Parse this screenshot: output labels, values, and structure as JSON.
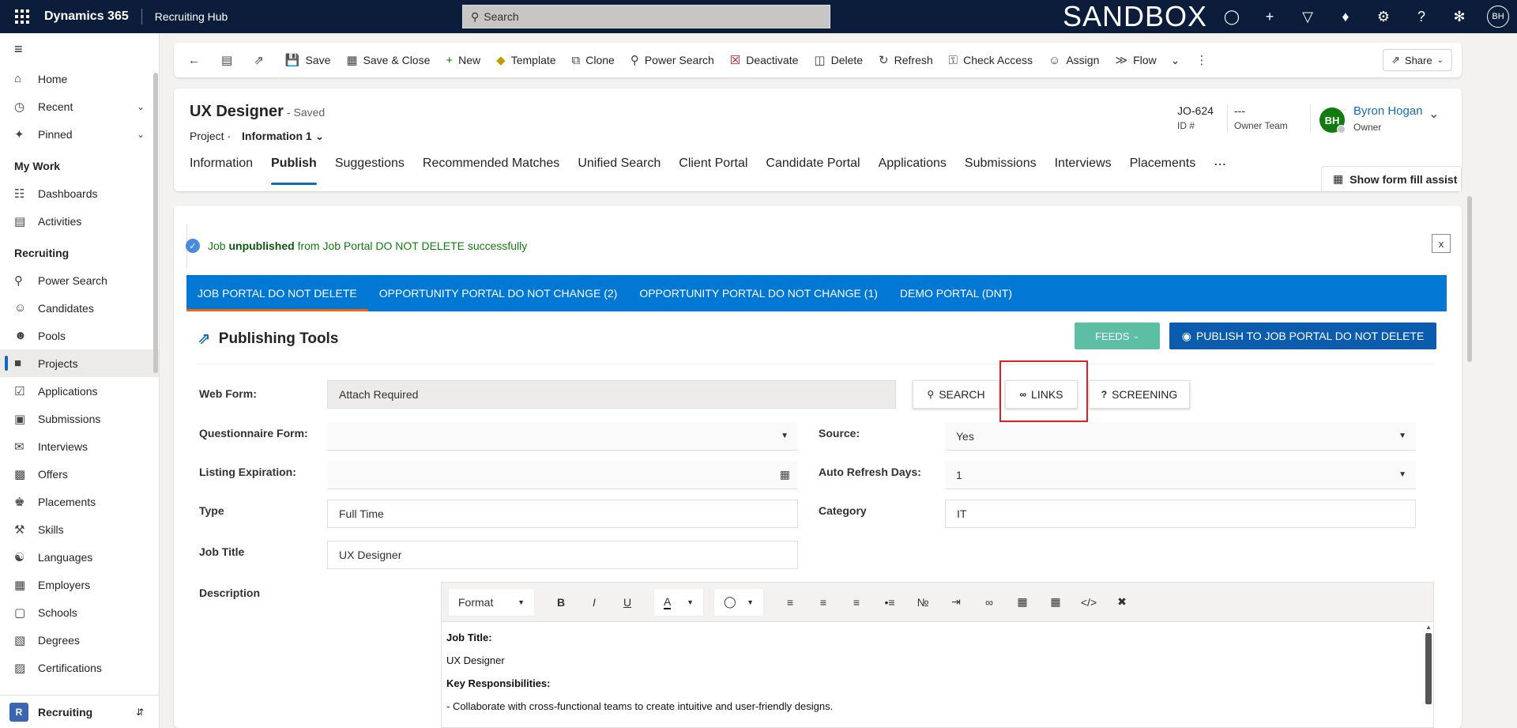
{
  "topbar": {
    "app_name": "Dynamics 365",
    "hub_name": "Recruiting Hub",
    "search_placeholder": "Search",
    "env_label": "SANDBOX",
    "user_initials": "BH"
  },
  "sidebar": {
    "items_top": [
      {
        "label": "Home",
        "icon": "home-icon"
      },
      {
        "label": "Recent",
        "icon": "clock-icon"
      },
      {
        "label": "Pinned",
        "icon": "pin-icon"
      }
    ],
    "group_mywork": "My Work",
    "items_mywork": [
      {
        "label": "Dashboards",
        "icon": "dashboard-icon"
      },
      {
        "label": "Activities",
        "icon": "clipboard-icon"
      }
    ],
    "group_recruiting": "Recruiting",
    "items_recruiting": [
      {
        "label": "Power Search",
        "icon": "search-icon"
      },
      {
        "label": "Candidates",
        "icon": "person-icon"
      },
      {
        "label": "Pools",
        "icon": "people-icon"
      },
      {
        "label": "Projects",
        "icon": "briefcase-icon"
      },
      {
        "label": "Applications",
        "icon": "check-doc-icon"
      },
      {
        "label": "Submissions",
        "icon": "inbox-icon"
      },
      {
        "label": "Interviews",
        "icon": "chat-icon"
      },
      {
        "label": "Offers",
        "icon": "document-icon"
      },
      {
        "label": "Placements",
        "icon": "group-icon"
      },
      {
        "label": "Skills",
        "icon": "tools-icon"
      },
      {
        "label": "Languages",
        "icon": "globe-icon"
      },
      {
        "label": "Employers",
        "icon": "building-icon"
      },
      {
        "label": "Schools",
        "icon": "school-icon"
      },
      {
        "label": "Degrees",
        "icon": "abc-icon"
      },
      {
        "label": "Certifications",
        "icon": "certificate-icon"
      }
    ],
    "area_badge": "R",
    "area_label": "Recruiting"
  },
  "commandbar": {
    "save": "Save",
    "save_close": "Save & Close",
    "new": "New",
    "template": "Template",
    "clone": "Clone",
    "power_search": "Power Search",
    "deactivate": "Deactivate",
    "delete": "Delete",
    "refresh": "Refresh",
    "check_access": "Check Access",
    "assign": "Assign",
    "flow": "Flow",
    "share": "Share"
  },
  "record": {
    "title": "UX Designer",
    "status": "- Saved",
    "entity": "Project",
    "form_name": "Information 1",
    "id_value": "JO-624",
    "id_label": "ID #",
    "owner_team_value": "---",
    "owner_team_label": "Owner Team",
    "owner_initials": "BH",
    "owner_name": "Byron Hogan",
    "owner_label": "Owner"
  },
  "tabs": [
    "Information",
    "Publish",
    "Suggestions",
    "Recommended Matches",
    "Unified Search",
    "Client Portal",
    "Candidate Portal",
    "Applications",
    "Submissions",
    "Interviews",
    "Placements"
  ],
  "form_assist": "Show form fill assist",
  "notice": {
    "prefix": "Job",
    "bold": "unpublished",
    "suffix": "from Job Portal DO NOT DELETE successfully",
    "close": "x"
  },
  "portal_tabs": [
    "JOB PORTAL DO NOT DELETE",
    "OPPORTUNITY PORTAL DO NOT CHANGE (2)",
    "OPPORTUNITY PORTAL DO NOT CHANGE (1)",
    "DEMO PORTAL (DNT)"
  ],
  "publishing": {
    "title": "Publishing Tools",
    "feeds": "FEEDS",
    "publish": "PUBLISH TO JOB PORTAL DO NOT DELETE"
  },
  "form": {
    "web_form_label": "Web Form:",
    "web_form_value": "Attach Required",
    "search_btn": "SEARCH",
    "links_btn": "LINKS",
    "screening_btn": "SCREENING",
    "questionnaire_label": "Questionnaire Form:",
    "questionnaire_value": "",
    "source_label": "Source:",
    "source_value": "Yes",
    "expiration_label": "Listing Expiration:",
    "expiration_value": "",
    "refresh_days_label": "Auto Refresh Days:",
    "refresh_days_value": "1",
    "type_label": "Type",
    "type_value": "Full Time",
    "category_label": "Category",
    "category_value": "IT",
    "job_title_label": "Job Title",
    "job_title_value": "UX Designer",
    "description_label": "Description"
  },
  "editor": {
    "format": "Format",
    "bold": "B",
    "italic": "I",
    "underline": "U",
    "font_color": "A",
    "line1_bold": "Job Title:",
    "line2": "UX Designer",
    "line3_bold": "Key Responsibilities:",
    "line4": "- Collaborate with cross-functional teams to create intuitive and user-friendly designs."
  }
}
